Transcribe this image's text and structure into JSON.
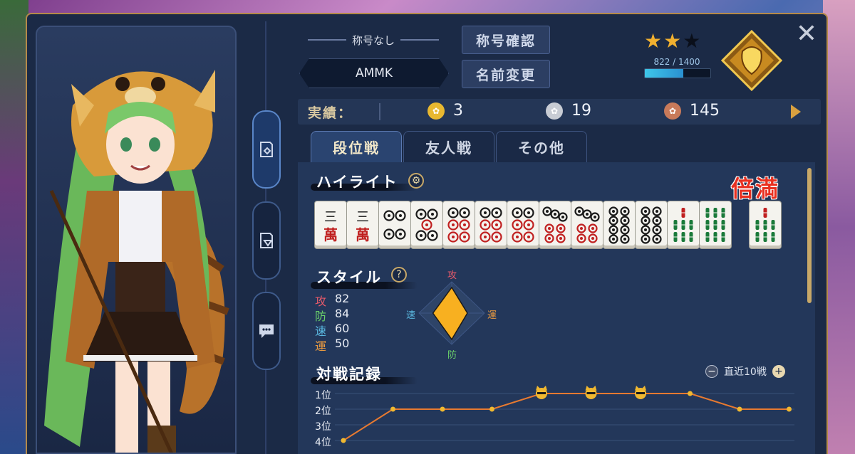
{
  "profile": {
    "title": "称号なし",
    "name": "AMMK",
    "btn_title_check": "称号確認",
    "btn_name_change": "名前変更",
    "exp_text": "822 / 1400",
    "exp_fraction": 0.587,
    "stars_filled": 2,
    "stars_total": 3
  },
  "record": {
    "label": "実績：",
    "gold": "3",
    "silver": "19",
    "bronze": "145"
  },
  "tabs": [
    "段位戦",
    "友人戦",
    "その他"
  ],
  "highlight": {
    "title": "ハイライト",
    "yaku": "倍満",
    "tiles": [
      {
        "suit": "man",
        "rank": 3,
        "top": "三",
        "bottom": "萬"
      },
      {
        "suit": "man",
        "rank": 3,
        "top": "三",
        "bottom": "萬"
      },
      {
        "suit": "pin",
        "rank": 4
      },
      {
        "suit": "pin",
        "rank": 5
      },
      {
        "suit": "pin",
        "rank": 6
      },
      {
        "suit": "pin",
        "rank": 6
      },
      {
        "suit": "pin",
        "rank": 6
      },
      {
        "suit": "pin",
        "rank": 7
      },
      {
        "suit": "pin",
        "rank": 7
      },
      {
        "suit": "pin",
        "rank": 8
      },
      {
        "suit": "pin",
        "rank": 8
      },
      {
        "suit": "sou",
        "rank": 7
      },
      {
        "suit": "sou",
        "rank": 9
      }
    ],
    "win_tile": {
      "suit": "sou",
      "rank": 7
    }
  },
  "style": {
    "title": "スタイル",
    "help": "?",
    "stats": [
      {
        "label": "攻",
        "value": "82",
        "color": "#e85a6a"
      },
      {
        "label": "防",
        "value": "84",
        "color": "#6ad06a"
      },
      {
        "label": "速",
        "value": "60",
        "color": "#5ab8e0"
      },
      {
        "label": "運",
        "value": "50",
        "color": "#e89a40"
      }
    ],
    "radar_top": "攻",
    "radar_bottom": "防",
    "radar_left": "速",
    "radar_right": "運",
    "radar_fill": "#f8b020"
  },
  "battle": {
    "title": "対戦記録",
    "filter_label": "直近10戦",
    "rank_labels": [
      "1位",
      "2位",
      "3位",
      "4位"
    ],
    "results": [
      4,
      2,
      2,
      2,
      1,
      1,
      1,
      1,
      2,
      2
    ],
    "line_color": "#e87a30"
  },
  "colors": {
    "gold": "#e8b830",
    "silver": "#c8ccd4",
    "bronze": "#c87a5a"
  }
}
